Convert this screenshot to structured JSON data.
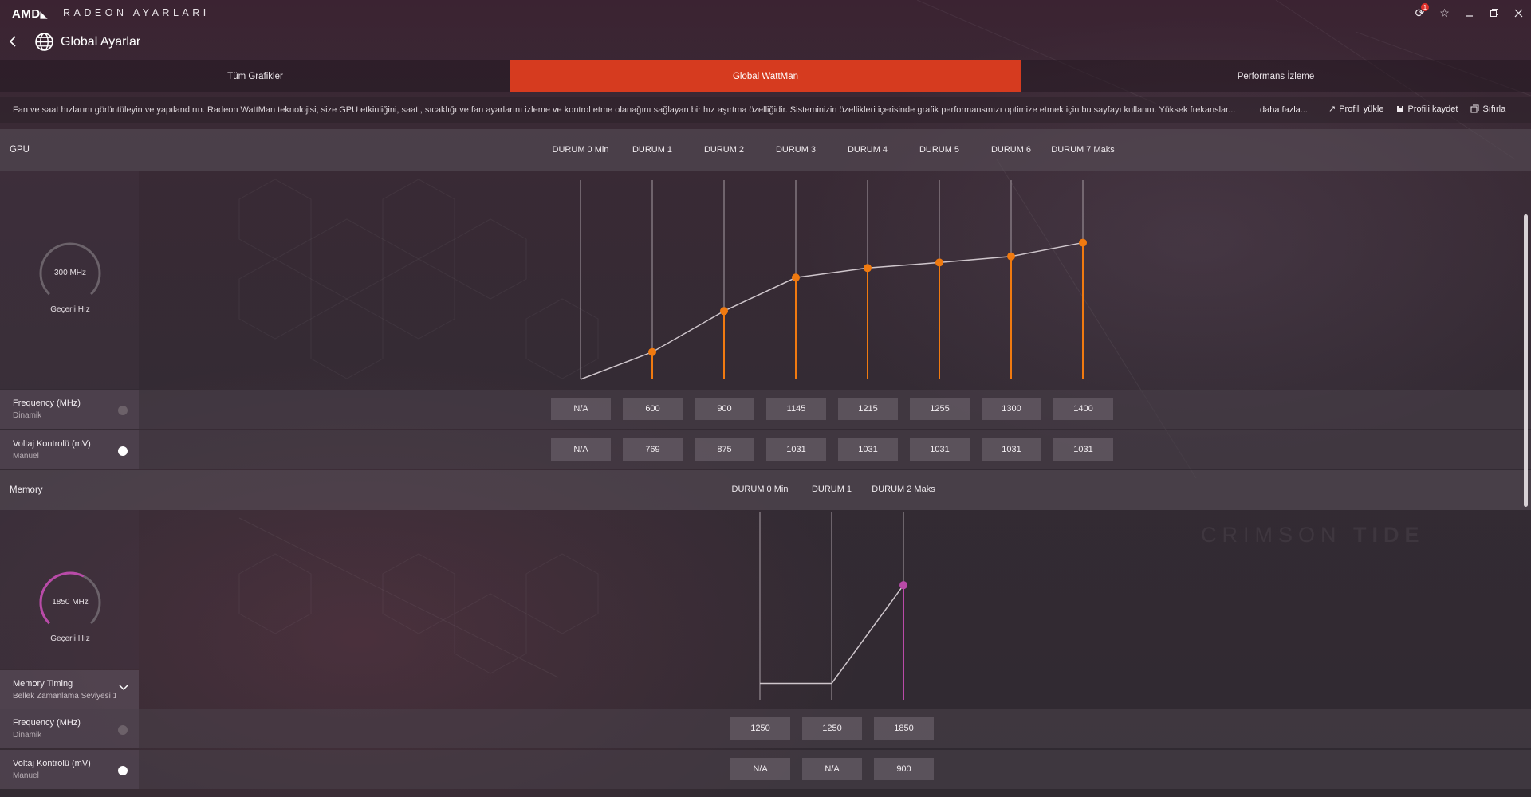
{
  "titlebar": {
    "logo": "AMD",
    "logo_arrow": "◣",
    "app_title": "RADEON AYARLARI",
    "notification_count": "1"
  },
  "header": {
    "title": "Global Ayarlar"
  },
  "tabs": [
    {
      "label": "Tüm Grafikler",
      "active": false
    },
    {
      "label": "Global WattMan",
      "active": true
    },
    {
      "label": "Performans İzleme",
      "active": false
    }
  ],
  "infobar": {
    "text": "Fan ve saat hızlarını görüntüleyin ve yapılandırın. Radeon WattMan teknolojisi, size GPU etkinliğini, saati, sıcaklığı ve fan ayarlarını izleme ve kontrol etme olanağını sağlayan bir hız aşırtma özelliğidir. Sisteminizin özellikleri içerisinde grafik performansınızı optimize etmek için bu sayfayı kullanın. Yüksek frekanslar...",
    "more_label": "daha fazla...",
    "load_profile": "Profili yükle",
    "save_profile": "Profili kaydet",
    "reset": "Sıfırla"
  },
  "gpu": {
    "section_title": "GPU",
    "stages": [
      "DURUM 0 Min",
      "DURUM 1",
      "DURUM 2",
      "DURUM 3",
      "DURUM 4",
      "DURUM 5",
      "DURUM 6",
      "DURUM 7 Maks"
    ],
    "gauge_value": "300 MHz",
    "gauge_fraction": 0.0,
    "gauge_caption": "Geçerli Hız",
    "frequency": {
      "label": "Frequency (MHz)",
      "mode": "Dinamik",
      "toggle_on": false,
      "values": [
        "N/A",
        "600",
        "900",
        "1145",
        "1215",
        "1255",
        "1300",
        "1400"
      ]
    },
    "voltage": {
      "label": "Voltaj Kontrolü (mV)",
      "mode": "Manuel",
      "toggle_on": true,
      "values": [
        "N/A",
        "769",
        "875",
        "1031",
        "1031",
        "1031",
        "1031",
        "1031"
      ]
    },
    "accent": "#f07a10"
  },
  "memory": {
    "section_title": "Memory",
    "stages": [
      "DURUM 0 Min",
      "DURUM 1",
      "DURUM 2 Maks"
    ],
    "gauge_value": "1850 MHz",
    "gauge_fraction": 0.6,
    "gauge_caption": "Geçerli Hız",
    "timing": {
      "label": "Memory Timing",
      "value": "Bellek Zamanlama Seviyesi 1"
    },
    "frequency": {
      "label": "Frequency (MHz)",
      "mode": "Dinamik",
      "toggle_on": false,
      "values": [
        "1250",
        "1250",
        "1850"
      ]
    },
    "voltage": {
      "label": "Voltaj Kontrolü (mV)",
      "mode": "Manuel",
      "toggle_on": true,
      "values": [
        "N/A",
        "N/A",
        "900"
      ]
    },
    "accent": "#b94aa8"
  },
  "watermark": {
    "light": "CRIMSON ",
    "bold": "TIDE"
  },
  "colors": {
    "active_tab": "#d63b1f",
    "gpu_accent": "#f07a10",
    "memory_accent": "#b94aa8"
  }
}
